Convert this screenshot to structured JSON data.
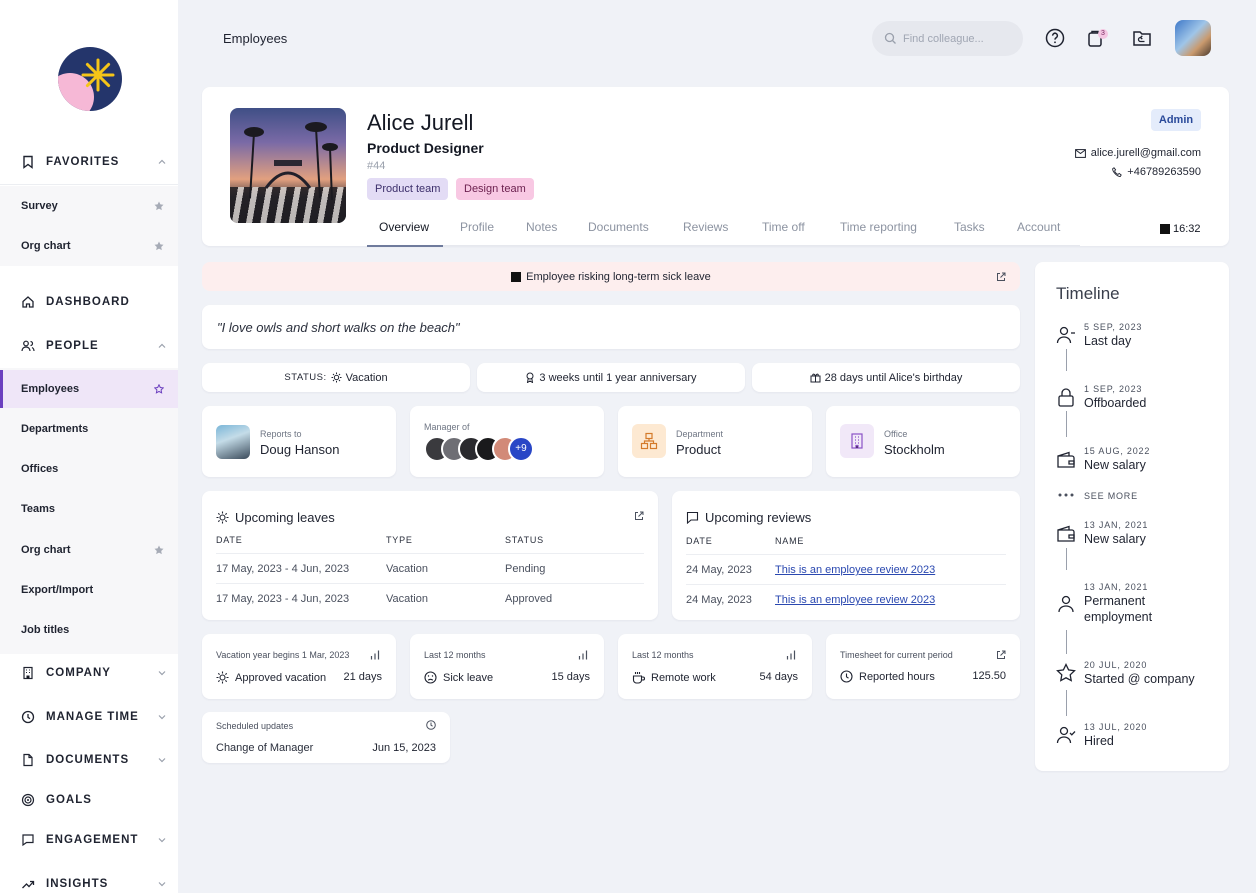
{
  "header": {
    "title": "Employees",
    "search_placeholder": "Find colleague...",
    "notification_count": "3"
  },
  "sidebar": {
    "favorites_label": "FAVORITES",
    "favorites": [
      {
        "label": "Survey"
      },
      {
        "label": "Org chart"
      }
    ],
    "dashboard_label": "DASHBOARD",
    "people_label": "PEOPLE",
    "people_items": [
      {
        "label": "Employees"
      },
      {
        "label": "Departments"
      },
      {
        "label": "Offices"
      },
      {
        "label": "Teams"
      },
      {
        "label": "Org chart"
      },
      {
        "label": "Export/Import"
      },
      {
        "label": "Job titles"
      }
    ],
    "company_label": "COMPANY",
    "manage_time_label": "MANAGE TIME",
    "documents_label": "DOCUMENTS",
    "goals_label": "GOALS",
    "engagement_label": "ENGAGEMENT",
    "insights_label": "INSIGHTS"
  },
  "profile": {
    "name": "Alice Jurell",
    "title": "Product Designer",
    "id": "#44",
    "tags": [
      "Product team",
      "Design team"
    ],
    "role_badge": "Admin",
    "email": "alice.jurell@gmail.com",
    "phone": "+46789263590",
    "local_time": "16:32",
    "tabs": [
      "Overview",
      "Profile",
      "Notes",
      "Documents",
      "Reviews",
      "Time off",
      "Time reporting",
      "Tasks",
      "Account"
    ]
  },
  "alert": {
    "text": "Employee risking long-term sick leave"
  },
  "quote": "\"I love owls and short walks on the beach\"",
  "pills": {
    "status_label": "STATUS:",
    "status_value": "Vacation",
    "anniversary": "3 weeks until 1 year anniversary",
    "birthday": "28 days until Alice's birthday"
  },
  "info": {
    "reports_to_label": "Reports to",
    "reports_to_value": "Doug Hanson",
    "manager_of_label": "Manager of",
    "manager_of_more": "+9",
    "department_label": "Department",
    "department_value": "Product",
    "office_label": "Office",
    "office_value": "Stockholm"
  },
  "leaves": {
    "title": "Upcoming leaves",
    "headers": [
      "DATE",
      "TYPE",
      "STATUS"
    ],
    "rows": [
      {
        "date": "17 May, 2023 - 4 Jun, 2023",
        "type": "Vacation",
        "status": "Pending"
      },
      {
        "date": "17 May, 2023 - 4 Jun, 2023",
        "type": "Vacation",
        "status": "Approved"
      }
    ]
  },
  "reviews": {
    "title": "Upcoming reviews",
    "headers": [
      "DATE",
      "NAME"
    ],
    "rows": [
      {
        "date": "24 May, 2023",
        "name": "This is an employee review 2023"
      },
      {
        "date": "24 May, 2023",
        "name": "This is an employee review 2023"
      }
    ]
  },
  "stats": [
    {
      "label": "Vacation year begins 1 Mar, 2023",
      "key": "Approved vacation",
      "value": "21 days"
    },
    {
      "label": "Last 12 months",
      "key": "Sick leave",
      "value": "15 days"
    },
    {
      "label": "Last 12 months",
      "key": "Remote work",
      "value": "54 days"
    },
    {
      "label": "Timesheet for current period",
      "key": "Reported hours",
      "value": "125.50"
    }
  ],
  "scheduled": {
    "label": "Scheduled updates",
    "key": "Change of Manager",
    "value": "Jun 15, 2023"
  },
  "timeline": {
    "title": "Timeline",
    "see_more": "SEE MORE",
    "events": [
      {
        "date": "5 SEP, 2023",
        "label": "Last day",
        "icon": "user-minus-icon"
      },
      {
        "date": "1 SEP, 2023",
        "label": "Offboarded",
        "icon": "lock-icon"
      },
      {
        "date": "15 AUG, 2022",
        "label": "New salary",
        "icon": "wallet-icon"
      },
      {
        "date": "13 JAN, 2021",
        "label": "New salary",
        "icon": "wallet-icon"
      },
      {
        "date": "13 JAN, 2021",
        "label": "Permanent employment",
        "icon": "user-icon"
      },
      {
        "date": "20 JUL, 2020",
        "label": "Started @ company",
        "icon": "star-icon"
      },
      {
        "date": "13 JUL, 2020",
        "label": "Hired",
        "icon": "user-check-icon"
      }
    ]
  },
  "colors": {
    "accent": "#6b3fbf",
    "alert_bg": "#fdeeee",
    "link": "#2a48b0",
    "tag_product": "#e3dcf5",
    "tag_design": "#f8c8e3"
  }
}
